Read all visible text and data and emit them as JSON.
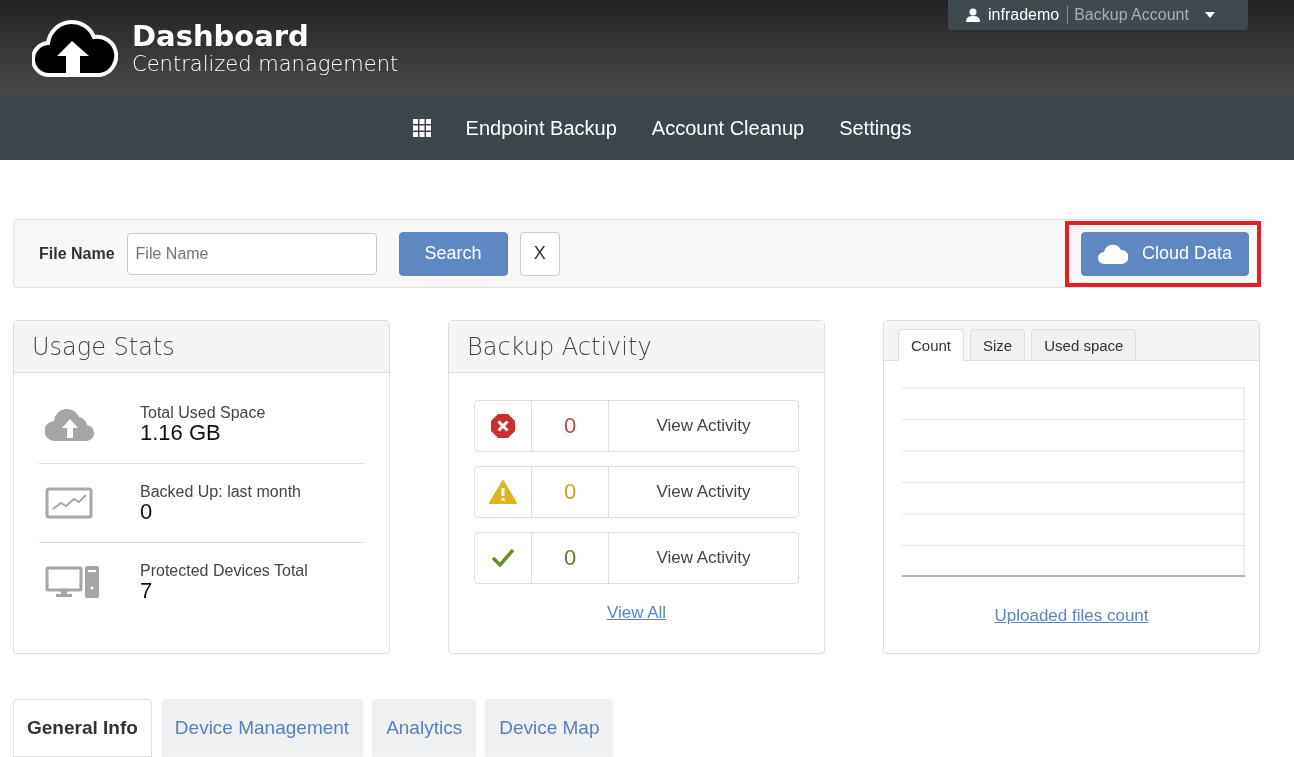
{
  "header": {
    "title": "Dashboard",
    "subtitle": "Centralized management",
    "user": "infrademo",
    "account": "Backup Account"
  },
  "nav": {
    "items": [
      "Endpoint Backup",
      "Account Cleanup",
      "Settings"
    ]
  },
  "search": {
    "label": "File Name",
    "placeholder": "File Name",
    "search_button": "Search",
    "clear_button": "X",
    "cloud_button": "Cloud Data",
    "cloud_highlighted": true
  },
  "usage_stats": {
    "title": "Usage Stats",
    "items": [
      {
        "kind": "space",
        "label": "Total Used Space",
        "value": "1.16 GB"
      },
      {
        "kind": "backup",
        "label": "Backed Up: last month",
        "value": "0"
      },
      {
        "kind": "devices",
        "label": "Protected Devices Total",
        "value": "7"
      }
    ]
  },
  "backup_activity": {
    "title": "Backup Activity",
    "rows": [
      {
        "kind": "error",
        "count": "0",
        "action": "View Activity"
      },
      {
        "kind": "warning",
        "count": "0",
        "action": "View Activity"
      },
      {
        "kind": "success",
        "count": "0",
        "action": "View Activity"
      }
    ],
    "view_all": "View All"
  },
  "chart_panel": {
    "tabs": [
      {
        "label": "Count",
        "selected": true
      },
      {
        "label": "Size",
        "selected": false
      },
      {
        "label": "Used space",
        "selected": false
      }
    ],
    "link": "Uploaded files count"
  },
  "bottom_tabs": [
    {
      "label": "General Info",
      "selected": true
    },
    {
      "label": "Device Management",
      "selected": false
    },
    {
      "label": "Analytics",
      "selected": false
    },
    {
      "label": "Device Map",
      "selected": false
    }
  ]
}
